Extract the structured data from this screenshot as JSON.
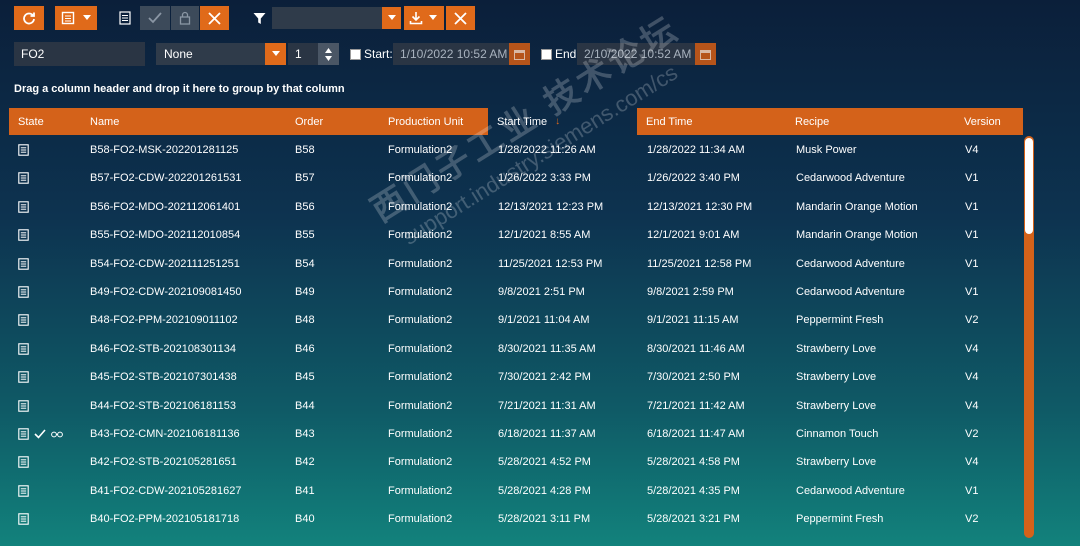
{
  "toolbar": {
    "refresh_icon": "refresh-icon",
    "layout_icon": "layout-icon",
    "details_icon": "document-icon",
    "accept_icon": "checkmark-icon",
    "lock_icon": "lock-icon",
    "cancel_icon": "close-icon",
    "filter_icon": "filter-icon",
    "filter_value": "",
    "download_icon": "download-icon",
    "clear_filter_icon": "close-icon"
  },
  "filters": {
    "search_value": "FO2",
    "group_select": "None",
    "stepper_value": "1",
    "start_label": "Start:",
    "start_value": "1/10/2022 10:52 AM",
    "end_label": "End:",
    "end_value": "2/10/2022 10:52 AM"
  },
  "group_hint": "Drag a column header and drop it here to group by that column",
  "grid": {
    "columns": [
      "State",
      "Name",
      "Order",
      "Production Unit",
      "Start Time",
      "End Time",
      "Recipe",
      "Version"
    ],
    "sorted_column": "Start Time",
    "sort_direction": "descending",
    "rows": [
      {
        "state": [
          "document-icon"
        ],
        "name": "B58-FO2-MSK-202201281125",
        "order": "B58",
        "unit": "Formulation2",
        "start": "1/28/2022 11:26 AM",
        "end": "1/28/2022 11:34 AM",
        "recipe": "Musk Power",
        "version": "V4"
      },
      {
        "state": [
          "document-icon"
        ],
        "name": "B57-FO2-CDW-202201261531",
        "order": "B57",
        "unit": "Formulation2",
        "start": "1/26/2022 3:33 PM",
        "end": "1/26/2022 3:40 PM",
        "recipe": "Cedarwood Adventure",
        "version": "V1"
      },
      {
        "state": [
          "document-icon"
        ],
        "name": "B56-FO2-MDO-202112061401",
        "order": "B56",
        "unit": "Formulation2",
        "start": "12/13/2021 12:23 PM",
        "end": "12/13/2021 12:30 PM",
        "recipe": "Mandarin Orange Motion",
        "version": "V1"
      },
      {
        "state": [
          "document-icon"
        ],
        "name": "B55-FO2-MDO-202112010854",
        "order": "B55",
        "unit": "Formulation2",
        "start": "12/1/2021 8:55 AM",
        "end": "12/1/2021 9:01 AM",
        "recipe": "Mandarin Orange Motion",
        "version": "V1"
      },
      {
        "state": [
          "document-icon"
        ],
        "name": "B54-FO2-CDW-202111251251",
        "order": "B54",
        "unit": "Formulation2",
        "start": "11/25/2021 12:53 PM",
        "end": "11/25/2021 12:58 PM",
        "recipe": "Cedarwood Adventure",
        "version": "V1"
      },
      {
        "state": [
          "document-icon"
        ],
        "name": "B49-FO2-CDW-202109081450",
        "order": "B49",
        "unit": "Formulation2",
        "start": "9/8/2021 2:51 PM",
        "end": "9/8/2021 2:59 PM",
        "recipe": "Cedarwood Adventure",
        "version": "V1"
      },
      {
        "state": [
          "document-icon"
        ],
        "name": "B48-FO2-PPM-202109011102",
        "order": "B48",
        "unit": "Formulation2",
        "start": "9/1/2021 11:04 AM",
        "end": "9/1/2021 11:15 AM",
        "recipe": "Peppermint Fresh",
        "version": "V2"
      },
      {
        "state": [
          "document-icon"
        ],
        "name": "B46-FO2-STB-202108301134",
        "order": "B46",
        "unit": "Formulation2",
        "start": "8/30/2021 11:35 AM",
        "end": "8/30/2021 11:46 AM",
        "recipe": "Strawberry Love",
        "version": "V4"
      },
      {
        "state": [
          "document-icon"
        ],
        "name": "B45-FO2-STB-202107301438",
        "order": "B45",
        "unit": "Formulation2",
        "start": "7/30/2021 2:42 PM",
        "end": "7/30/2021 2:50 PM",
        "recipe": "Strawberry Love",
        "version": "V4"
      },
      {
        "state": [
          "document-icon"
        ],
        "name": "B44-FO2-STB-202106181153",
        "order": "B44",
        "unit": "Formulation2",
        "start": "7/21/2021 11:31 AM",
        "end": "7/21/2021 11:42 AM",
        "recipe": "Strawberry Love",
        "version": "V4"
      },
      {
        "state": [
          "document-icon",
          "checkmark-icon",
          "glasses-icon"
        ],
        "name": "B43-FO2-CMN-202106181136",
        "order": "B43",
        "unit": "Formulation2",
        "start": "6/18/2021 11:37 AM",
        "end": "6/18/2021 11:47 AM",
        "recipe": "Cinnamon Touch",
        "version": "V2"
      },
      {
        "state": [
          "document-icon"
        ],
        "name": "B42-FO2-STB-202105281651",
        "order": "B42",
        "unit": "Formulation2",
        "start": "5/28/2021 4:52 PM",
        "end": "5/28/2021 4:58 PM",
        "recipe": "Strawberry Love",
        "version": "V4"
      },
      {
        "state": [
          "document-icon"
        ],
        "name": "B41-FO2-CDW-202105281627",
        "order": "B41",
        "unit": "Formulation2",
        "start": "5/28/2021 4:28 PM",
        "end": "5/28/2021 4:35 PM",
        "recipe": "Cedarwood Adventure",
        "version": "V1"
      },
      {
        "state": [
          "document-icon"
        ],
        "name": "B40-FO2-PPM-202105181718",
        "order": "B40",
        "unit": "Formulation2",
        "start": "5/28/2021 3:11 PM",
        "end": "5/28/2021 3:21 PM",
        "recipe": "Peppermint Fresh",
        "version": "V2"
      }
    ]
  },
  "watermark": {
    "line1": "西门子工业 技术论坛",
    "line2": "support.industry.siemens.com/cs"
  },
  "colors": {
    "accent": "#e06a1a",
    "header": "#d4621a",
    "input_bg": "#2a3544",
    "background_top": "#0b1f3a",
    "background_bottom": "#12827c"
  }
}
